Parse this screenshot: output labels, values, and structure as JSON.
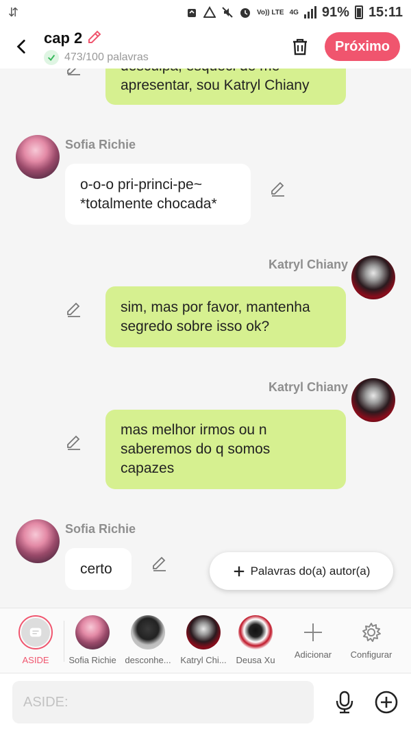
{
  "status_bar": {
    "battery": "91%",
    "time": "15:11",
    "network": "4G",
    "volte": "Vo)) LTE"
  },
  "header": {
    "title": "cap 2",
    "word_count": "473/100 palavras",
    "next_label": "Próximo"
  },
  "messages": [
    {
      "side": "right",
      "lines": [
        "desculpa, esqueci de me",
        "apresentar, sou Katryl Chiany"
      ]
    },
    {
      "side": "left",
      "author": "Sofia Richie",
      "lines": [
        "o-o-o pri-princi-pe~",
        "*totalmente chocada*"
      ]
    },
    {
      "side": "right",
      "author": "Katryl Chiany",
      "lines": [
        "sim, mas por favor, mantenha",
        "segredo sobre isso ok?"
      ]
    },
    {
      "side": "right",
      "author": "Katryl Chiany",
      "lines": [
        "mas melhor irmos ou n",
        "saberemos do q somos",
        "capazes"
      ]
    },
    {
      "side": "left",
      "author": "Sofia Richie",
      "lines": [
        "certo"
      ]
    }
  ],
  "float_button": {
    "label": "Palavras do(a) autor(a)"
  },
  "characters": [
    {
      "label": "ASIDE"
    },
    {
      "label": "Sofia Richie"
    },
    {
      "label": "desconhe..."
    },
    {
      "label": "Katryl Chi..."
    },
    {
      "label": "Deusa Xu"
    },
    {
      "label": "Adicionar"
    },
    {
      "label": "Configurar"
    }
  ],
  "input": {
    "placeholder": "ASIDE:"
  },
  "colors": {
    "accent": "#f0556e",
    "green_bubble": "#d6f090",
    "white_bubble": "#ffffff"
  }
}
